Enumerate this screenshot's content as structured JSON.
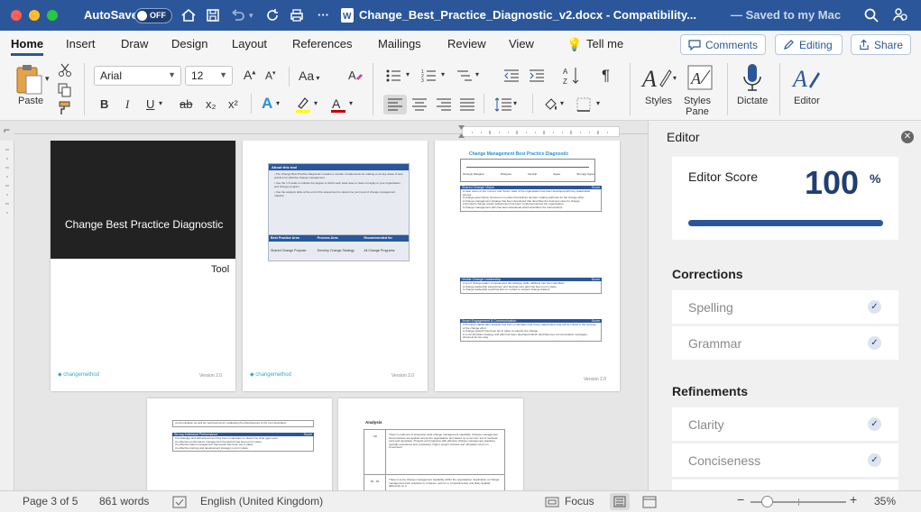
{
  "titlebar": {
    "autosave_label": "AutoSave",
    "autosave_state": "OFF",
    "document_title": "Change_Best_Practice_Diagnostic_v2.docx  -  Compatibility...",
    "save_status": "—  Saved to my Mac"
  },
  "tabs": [
    {
      "label": "Home",
      "active": true
    },
    {
      "label": "Insert"
    },
    {
      "label": "Draw"
    },
    {
      "label": "Design"
    },
    {
      "label": "Layout"
    },
    {
      "label": "References"
    },
    {
      "label": "Mailings"
    },
    {
      "label": "Review"
    },
    {
      "label": "View"
    },
    {
      "label": "Tell me"
    }
  ],
  "tab_buttons": {
    "comments": "Comments",
    "editing": "Editing",
    "share": "Share"
  },
  "ribbon": {
    "paste_label": "Paste",
    "font_name": "Arial",
    "font_size": "12",
    "styles_label": "Styles",
    "styles_pane_label": "Styles\nPane",
    "dictate_label": "Dictate",
    "editor_label": "Editor",
    "bold": "B",
    "italic": "I",
    "underline": "U",
    "strike": "ab",
    "subscript": "x₂",
    "superscript": "x²",
    "case_label": "Aa",
    "para_mark": "¶",
    "font_color": "#c00000",
    "highlight_color": "#ffff00"
  },
  "document": {
    "cover_title": "Change Best Practice Diagnostic",
    "cover_subtitle": "Tool",
    "footer_logo": "changemethod",
    "version": "Version 2.0",
    "about_heading": "About this tool",
    "about_bullets": [
      "The Change Best Practice Diagnostic contains a number of statements for relating to six key areas of best practice for effective change management.",
      "Use the 1-5 scale to indicate the degree to which each state does or does not apply to your organisation and change program.",
      "Use the analysis table at the end of the assessment to determine your level of change management maturity."
    ],
    "about_table": {
      "headers": [
        "Best Practice Area",
        "Process Area",
        "Recommended for"
      ],
      "row": [
        "Shared Change Purpose",
        "Develop Change Strategy",
        "All Change Programs"
      ]
    },
    "page3_title": "Change Management Best Practice Diagnostic",
    "scale_labels": [
      "Strongly Disagree",
      "Disagree",
      "Neutral",
      "Agree",
      "Strongly Agree"
    ],
    "score_label": "Score",
    "sections": [
      "Shared Change Vision",
      "Visible Change Leadership",
      "Smart Engagement & Communication",
      "Strong Individual Performance"
    ],
    "lines_shared": [
      "A clear vision of the 'current' and 'future' state of the organisation has been developed with key stakeholder groups.",
      "A change governance structure is in place that defines decision making authority for the change effort.",
      "A change management strategy has been developed that describes the business case for change.",
      "A thorough change impact assessment has been conducted across the organisation.",
      "A change management plan has been developed which describes the interventions."
    ],
    "lines_leadership": [
      "A set of change leader competencies (knowledge, skills, abilities) has been identified.",
      "A change leadership assessment and development plan has been put in place.",
      "A change leadership coaching plan is in place to support change leaders."
    ],
    "lines_engagement": [
      "A thorough stakeholder analysis has been undertaken that those stakeholders that will be critical to the success of the change effort.",
      "A change network has been put in place to support the change.",
      "A communication strategy and plan has been developed which describes key communication messages, channels for two-way."
    ],
    "lines_performance": [
      "communication as well as mechanisms for evaluating the effectiveness of the communication.",
      "A knowledge and skill assessment has been undertaken to determine what gaps exist.",
      "An effective performance management framework has been put in place.",
      "An effective talent management framework has been put in place.",
      "An effective training and development strategy is put in place."
    ],
    "analysis_heading": "Analysis",
    "analysis_rows": [
      {
        "range": ">90",
        "text": "There is evidence of enterprise-wide change management capability. Change management best practices are applied across the organisation and based on a common set of methods, tools and templates. Projects and programs with effective change management practices typically experience less resistance, higher project success and ultimately return on investment."
      },
      {
        "range": "50 - 69",
        "text": "There is some change management capability within the organisation. Application of change management best practices is, however, ad hoc or compartmental, and likely applied differently on a"
      }
    ]
  },
  "editor_pane": {
    "title": "Editor",
    "score_label": "Editor Score",
    "score_value": "100",
    "score_unit": "%",
    "score_fraction": 1.0,
    "corrections_heading": "Corrections",
    "corrections": [
      "Spelling",
      "Grammar"
    ],
    "refinements_heading": "Refinements",
    "refinements": [
      "Clarity",
      "Conciseness"
    ]
  },
  "statusbar": {
    "page": "Page 3 of 5",
    "words": "861 words",
    "language": "English (United Kingdom)",
    "focus": "Focus",
    "zoom": "35%",
    "zoom_fraction": 0.35
  },
  "colors": {
    "brand": "#2b579a",
    "accent": "#1f3f72"
  }
}
